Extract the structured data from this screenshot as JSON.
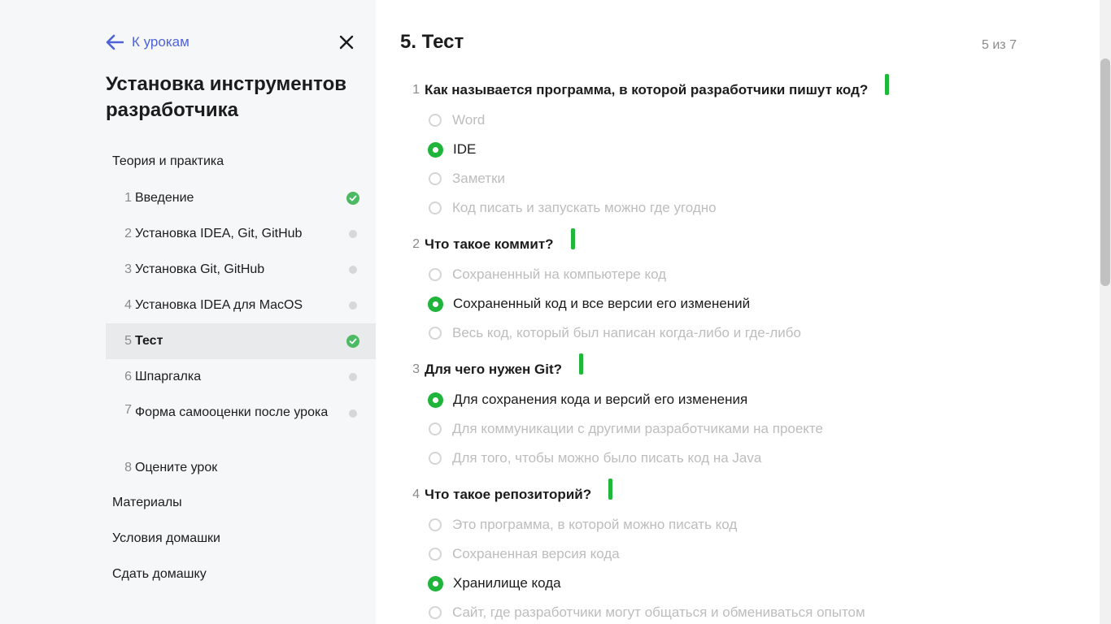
{
  "sidebar": {
    "back_label": "К урокам",
    "course_title": "Установка инструментов разработчика",
    "sections": {
      "theory": "Теория и практика",
      "materials": "Материалы",
      "homework_conditions": "Условия домашки",
      "submit_homework": "Сдать домашку"
    },
    "lessons": [
      {
        "num": "1",
        "label": "Введение",
        "status": "done"
      },
      {
        "num": "2",
        "label": "Установка IDEA, Git, GitHub",
        "status": "pending"
      },
      {
        "num": "3",
        "label": "Установка Git, GitHub",
        "status": "pending"
      },
      {
        "num": "4",
        "label": "Установка IDEA для MacOS",
        "status": "pending"
      },
      {
        "num": "5",
        "label": "Тест",
        "status": "done",
        "active": true
      },
      {
        "num": "6",
        "label": "Шпаргалка",
        "status": "pending"
      },
      {
        "num": "7",
        "label": "Форма самооценки после урока",
        "status": "pending"
      },
      {
        "num": "8",
        "label": "Оцените урок",
        "status": "none"
      }
    ]
  },
  "main": {
    "title": "5. Тест",
    "counter": "5 из 7",
    "questions": [
      {
        "num": "1",
        "text": "Как называется программа, в которой разработчики пишут код?",
        "options": [
          {
            "text": "Word",
            "selected": false
          },
          {
            "text": "IDE",
            "selected": true
          },
          {
            "text": "Заметки",
            "selected": false
          },
          {
            "text": "Код писать и запускать можно где угодно",
            "selected": false
          }
        ]
      },
      {
        "num": "2",
        "text": "Что такое коммит?",
        "options": [
          {
            "text": "Сохраненный на компьютере код",
            "selected": false
          },
          {
            "text": "Сохраненный код и все версии его изменений",
            "selected": true
          },
          {
            "text": "Весь код, который был написан когда-либо и где-либо",
            "selected": false
          }
        ]
      },
      {
        "num": "3",
        "text": "Для чего нужен Git?",
        "options": [
          {
            "text": "Для сохранения кода и версий его изменения",
            "selected": true
          },
          {
            "text": "Для коммуникации с другими разработчиками на проекте",
            "selected": false
          },
          {
            "text": "Для того, чтобы можно было писать код на Java",
            "selected": false
          }
        ]
      },
      {
        "num": "4",
        "text": "Что такое репозиторий?",
        "options": [
          {
            "text": "Это программа, в которой можно писать код",
            "selected": false
          },
          {
            "text": "Сохраненная версия кода",
            "selected": false
          },
          {
            "text": "Хранилище кода",
            "selected": true
          },
          {
            "text": "Сайт, где разработчики могут общаться и обмениваться опытом",
            "selected": false
          }
        ]
      }
    ]
  },
  "colors": {
    "accent_link": "#4f63d8",
    "success_green": "#1fb43a",
    "done_check": "#4cb963",
    "pending_dot": "#d6d7d9"
  }
}
